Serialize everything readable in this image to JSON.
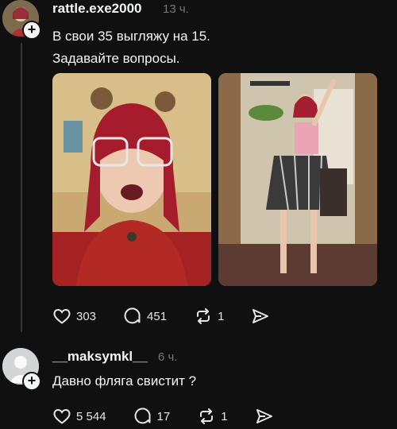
{
  "post": {
    "username": "rattle.exe2000",
    "time": "13 ч.",
    "lines": [
      "В свои 35 выгляжу на 15.",
      "Задавайте вопросы."
    ],
    "actions": {
      "likes": "303",
      "comments": "451",
      "reposts": "1"
    }
  },
  "reply": {
    "username": "__maksymkl__",
    "time": "6 ч.",
    "text": "Давно фляга свистит ?",
    "actions": {
      "likes": "5 544",
      "comments": "17",
      "reposts": "1"
    }
  },
  "icons": {
    "like": "heart-icon",
    "comment": "comment-icon",
    "repost": "repost-icon",
    "share": "send-icon",
    "follow": "plus-icon"
  }
}
